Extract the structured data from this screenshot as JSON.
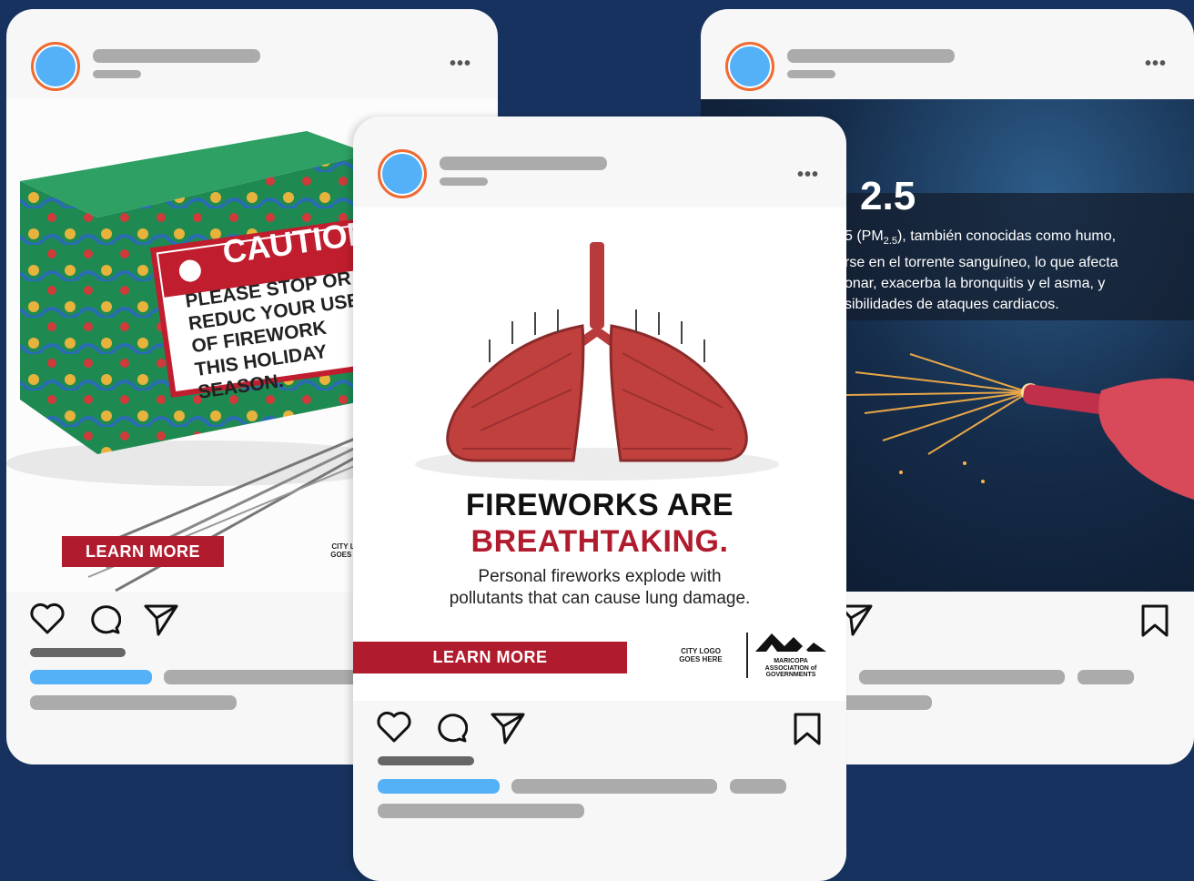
{
  "colors": {
    "background": "#17325e",
    "card": "#f7f7f8",
    "avatar": "#54b0f7",
    "avatar_ring": "#f26a30",
    "placeholder": "#ababab",
    "placeholder_accent": "#54b0f7",
    "brand_red": "#b01c2e"
  },
  "icons": [
    "more-icon",
    "heart-icon",
    "comment-icon",
    "share-icon",
    "bookmark-icon"
  ],
  "left_post": {
    "box_caution": "CAUTION",
    "box_message": "PLEASE STOP OR REDUC YOUR USE OF FIREWORK THIS HOLIDAY SEASON.",
    "button": "LEARN MORE",
    "logo": "CITY L GOES I"
  },
  "center_post": {
    "headline_1": "FIREWORKS ARE",
    "headline_2": "BREATHTAKING.",
    "body": "Personal fireworks explode with pollutants that can cause lung damage.",
    "button": "LEARN MORE",
    "city_logo": "CITY LOGO GOES HERE",
    "org_logo": "MARICOPA ASSOCIATION of GOVERNMENTS"
  },
  "right_post": {
    "heading": "2.5",
    "text_line_1": "5 (PM",
    "text_sub": "2.5",
    "text_line_1_end": "), también conocidas como humo,",
    "text_line_2": "rse en el torrente sanguíneo, lo que afecta",
    "text_line_3": "onar, exacerba la bronquitis y el asma, y",
    "text_line_4": "sibilidades de ataques cardiacos."
  }
}
